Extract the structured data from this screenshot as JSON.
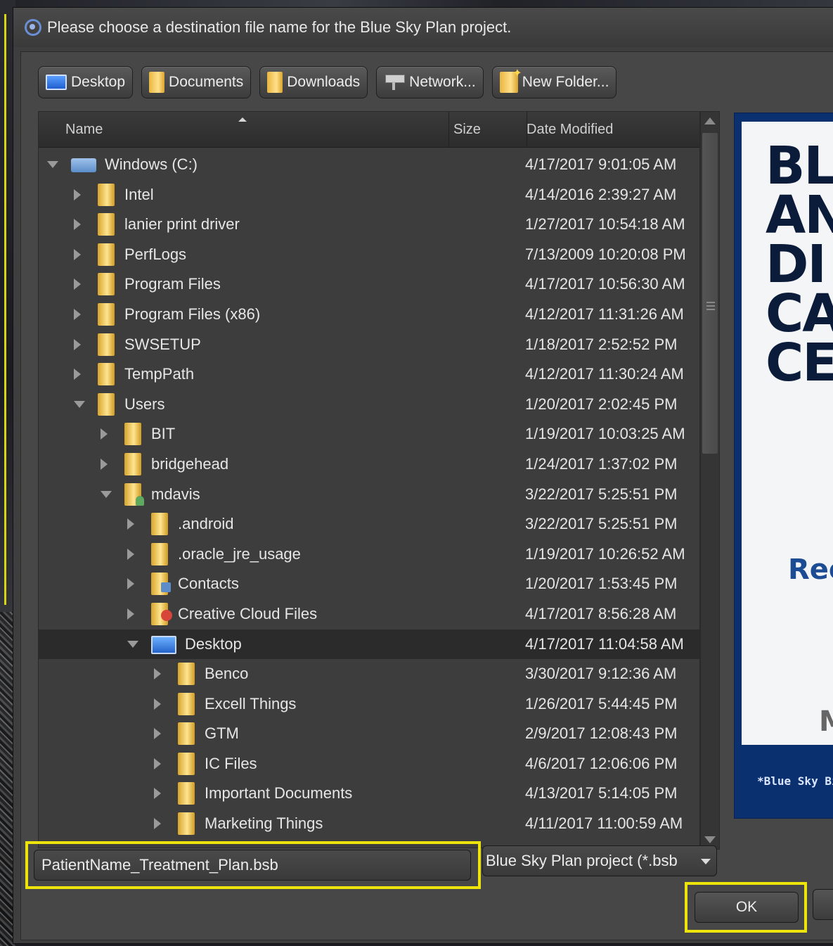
{
  "window": {
    "title": "Please choose a destination file name for the Blue Sky Plan project."
  },
  "toolbar": {
    "buttons": [
      {
        "label": "Desktop",
        "icon": "monitor-icon"
      },
      {
        "label": "Documents",
        "icon": "folder-icon"
      },
      {
        "label": "Downloads",
        "icon": "folder-icon"
      },
      {
        "label": "Network...",
        "icon": "network-icon"
      },
      {
        "label": "New Folder...",
        "icon": "new-folder-icon"
      }
    ]
  },
  "columns": {
    "name": "Name",
    "size": "Size",
    "date": "Date Modified"
  },
  "tree": [
    {
      "name": "Windows (C:)",
      "date": "4/17/2017 9:01:05 AM",
      "level": 0,
      "state": "expanded",
      "icon": "drive-icon"
    },
    {
      "name": "Intel",
      "date": "4/14/2016 2:39:27 AM",
      "level": 1,
      "state": "collapsed",
      "icon": "folder-icon"
    },
    {
      "name": "lanier print driver",
      "date": "1/27/2017 10:54:18 AM",
      "level": 1,
      "state": "collapsed",
      "icon": "folder-icon"
    },
    {
      "name": "PerfLogs",
      "date": "7/13/2009 10:20:08 PM",
      "level": 1,
      "state": "collapsed",
      "icon": "folder-icon"
    },
    {
      "name": "Program Files",
      "date": "4/17/2017 10:56:30 AM",
      "level": 1,
      "state": "collapsed",
      "icon": "folder-icon"
    },
    {
      "name": "Program Files (x86)",
      "date": "4/12/2017 11:31:26 AM",
      "level": 1,
      "state": "collapsed",
      "icon": "folder-icon"
    },
    {
      "name": "SWSETUP",
      "date": "1/18/2017 2:52:52 PM",
      "level": 1,
      "state": "collapsed",
      "icon": "folder-icon"
    },
    {
      "name": "TempPath",
      "date": "4/12/2017 11:30:24 AM",
      "level": 1,
      "state": "collapsed",
      "icon": "folder-icon"
    },
    {
      "name": "Users",
      "date": "1/20/2017 2:02:45 PM",
      "level": 1,
      "state": "expanded",
      "icon": "folder-icon"
    },
    {
      "name": "BIT",
      "date": "1/19/2017 10:03:25 AM",
      "level": 2,
      "state": "collapsed",
      "icon": "folder-icon"
    },
    {
      "name": "bridgehead",
      "date": "1/24/2017 1:37:02 PM",
      "level": 2,
      "state": "collapsed",
      "icon": "folder-icon"
    },
    {
      "name": "mdavis",
      "date": "3/22/2017 5:25:51 PM",
      "level": 2,
      "state": "expanded",
      "icon": "user-folder-icon"
    },
    {
      "name": ".android",
      "date": "3/22/2017 5:25:51 PM",
      "level": 3,
      "state": "collapsed",
      "icon": "folder-icon"
    },
    {
      "name": ".oracle_jre_usage",
      "date": "1/19/2017 10:26:52 AM",
      "level": 3,
      "state": "collapsed",
      "icon": "folder-icon"
    },
    {
      "name": "Contacts",
      "date": "1/20/2017 1:53:45 PM",
      "level": 3,
      "state": "collapsed",
      "icon": "contacts-folder-icon"
    },
    {
      "name": "Creative Cloud Files",
      "date": "4/17/2017 8:56:28 AM",
      "level": 3,
      "state": "collapsed",
      "icon": "creative-cloud-folder-icon"
    },
    {
      "name": "Desktop",
      "date": "4/17/2017 11:04:58 AM",
      "level": 3,
      "state": "expanded",
      "icon": "desktop-monitor-icon",
      "selected": true
    },
    {
      "name": "Benco",
      "date": "3/30/2017 9:12:36 AM",
      "level": 4,
      "state": "collapsed",
      "icon": "folder-icon"
    },
    {
      "name": "Excell Things",
      "date": "1/26/2017 5:44:45 PM",
      "level": 4,
      "state": "collapsed",
      "icon": "folder-icon"
    },
    {
      "name": "GTM",
      "date": "2/9/2017 12:08:43 PM",
      "level": 4,
      "state": "collapsed",
      "icon": "folder-icon"
    },
    {
      "name": "IC Files",
      "date": "4/6/2017 12:06:06 PM",
      "level": 4,
      "state": "collapsed",
      "icon": "folder-icon"
    },
    {
      "name": "Important Documents",
      "date": "4/13/2017 5:14:05 PM",
      "level": 4,
      "state": "collapsed",
      "icon": "folder-icon"
    },
    {
      "name": "Marketing Things",
      "date": "4/11/2017 11:00:59 AM",
      "level": 4,
      "state": "collapsed",
      "icon": "folder-icon"
    }
  ],
  "preview": {
    "headline": [
      "BL",
      "AN",
      "DI",
      "CA",
      "CE"
    ],
    "subline": "Rec",
    "bottom_letter": "M",
    "footer": "*Blue Sky Bio"
  },
  "filename": {
    "value": "PatientName_Treatment_Plan.bsb"
  },
  "filetype": {
    "selected": "Blue Sky Plan project (*.bsb"
  },
  "buttons": {
    "ok": "OK"
  },
  "colors": {
    "highlight": "#ece40a",
    "dialog_bg": "#474747"
  }
}
